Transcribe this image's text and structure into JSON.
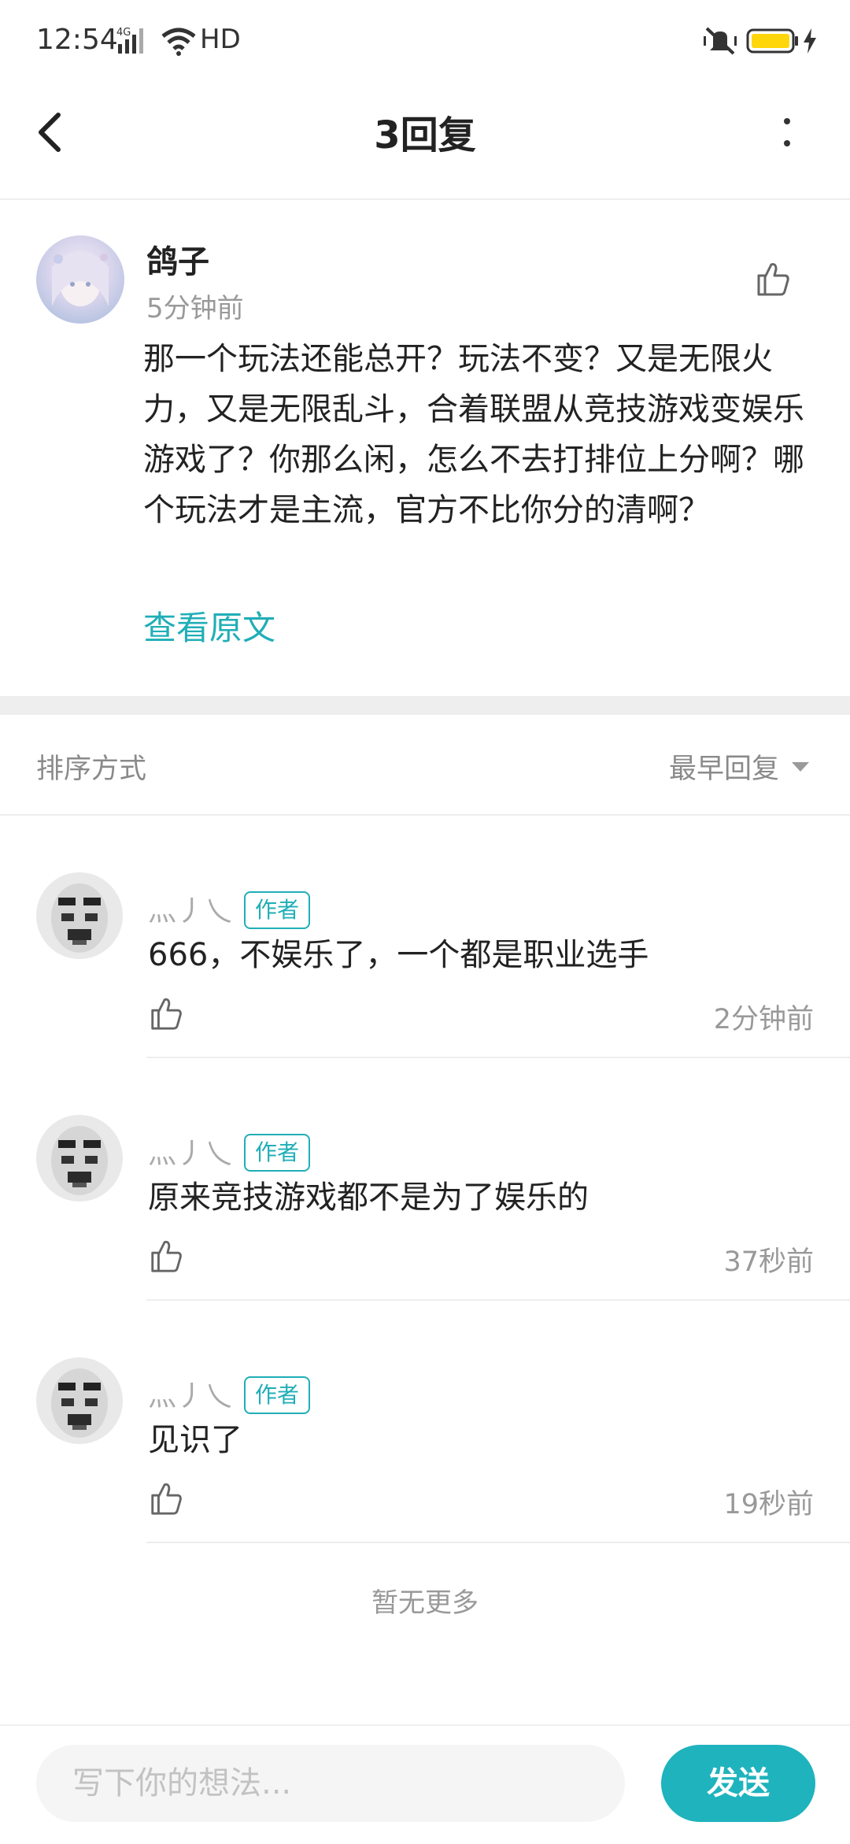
{
  "status_bar": {
    "time": "12:54",
    "network": "HD",
    "icons": [
      "signal-4g-icon",
      "wifi-icon",
      "mute-vibrate-icon",
      "battery-icon",
      "charging-icon"
    ],
    "battery_color": "#ffd60a"
  },
  "header": {
    "title": "3回复",
    "back_icon": "chevron-left-icon",
    "more_icon": "more-vertical-icon"
  },
  "post": {
    "author": "鸽子",
    "time": "5分钟前",
    "body": "那一个玩法还能总开？玩法不变？又是无限火力，又是无限乱斗，合着联盟从竞技游戏变娱乐游戏了？你那么闲，怎么不去打排位上分啊？哪个玩法才是主流，官方不比你分的清啊？",
    "view_original": "查看原文"
  },
  "sort": {
    "label": "排序方式",
    "value": "最早回复"
  },
  "replies": [
    {
      "name": "灬丿乀",
      "badge": "作者",
      "text": "666，不娱乐了，一个都是职业选手",
      "time": "2分钟前"
    },
    {
      "name": "灬丿乀",
      "badge": "作者",
      "text": "原来竞技游戏都不是为了娱乐的",
      "time": "37秒前"
    },
    {
      "name": "灬丿乀",
      "badge": "作者",
      "text": "见识了",
      "time": "19秒前"
    }
  ],
  "no_more": "暂无更多",
  "input": {
    "placeholder": "写下你的想法...",
    "value": "",
    "send_label": "发送"
  },
  "colors": {
    "accent": "#1fb3bd",
    "link": "#20aeb7"
  }
}
